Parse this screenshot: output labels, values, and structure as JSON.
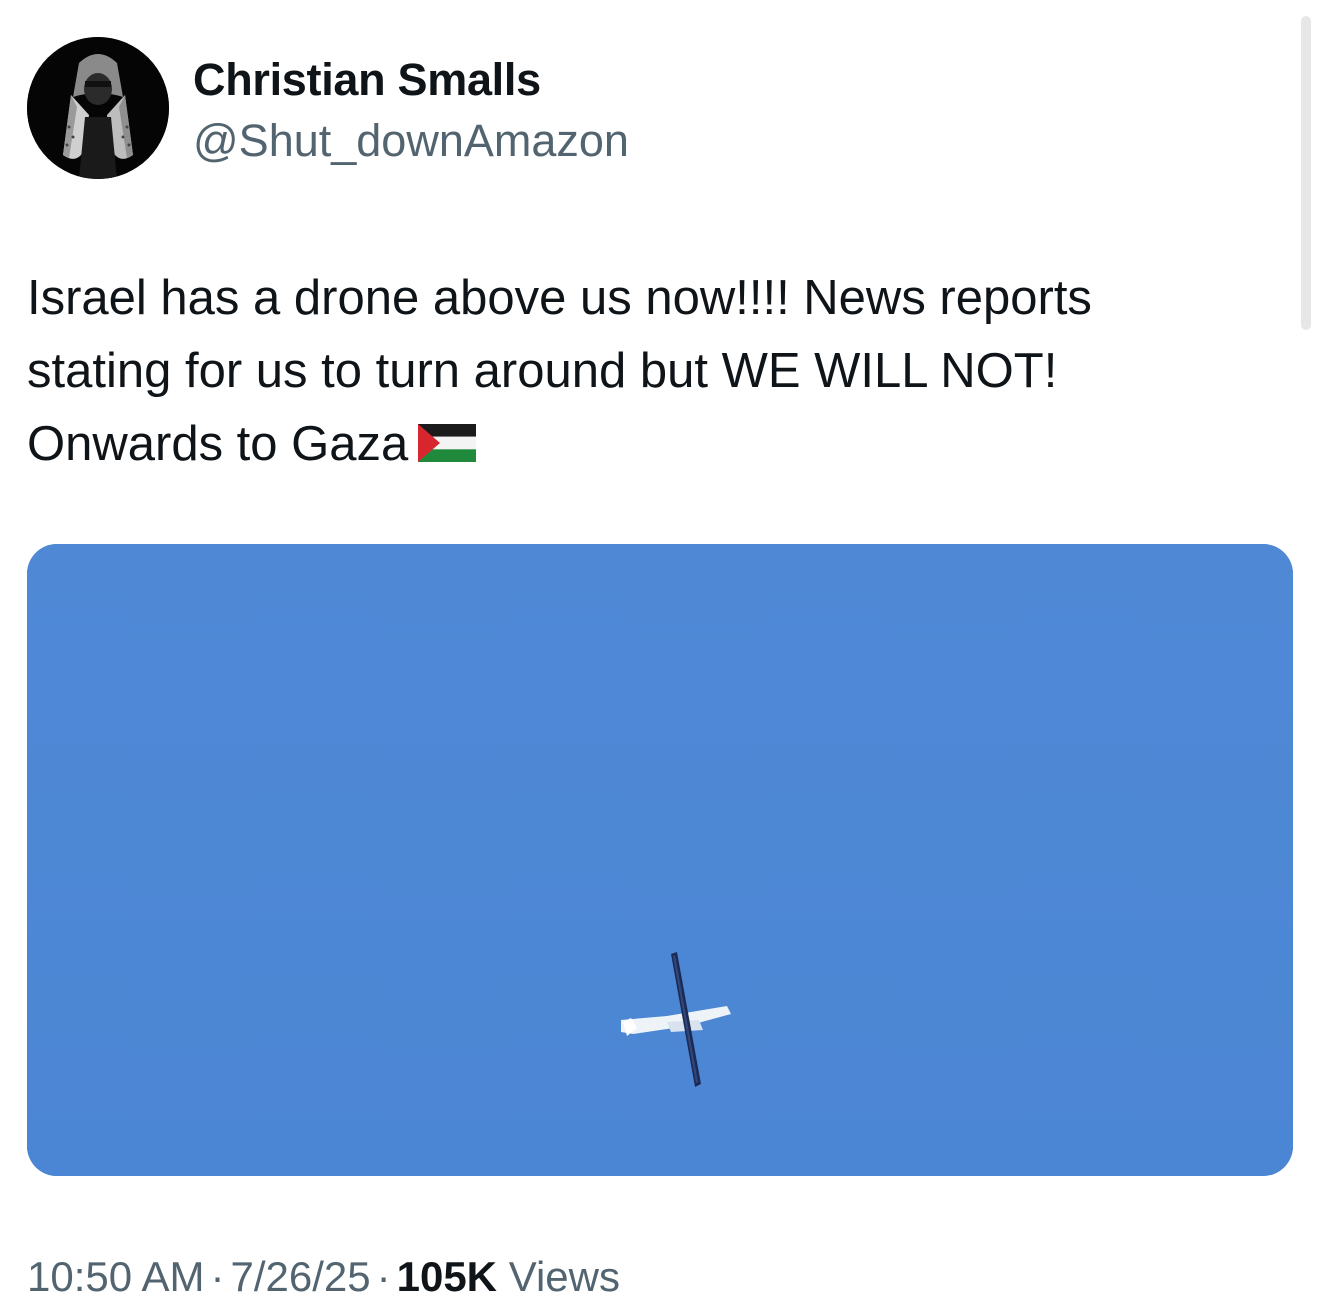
{
  "author": {
    "name": "Christian Smalls",
    "handle": "@Shut_downAmazon"
  },
  "tweet": {
    "lines": [
      "Israel has a drone above us now!!!! News reports",
      "stating for us to turn around but WE WILL NOT!",
      "Onwards to Gaza"
    ],
    "emoji": "palestine-flag-icon"
  },
  "media": {
    "sky_color": "#4d88d6"
  },
  "meta": {
    "time": "10:50 AM",
    "separator": "·",
    "date": "7/26/25",
    "views_count": "105K",
    "views_label": "Views"
  }
}
